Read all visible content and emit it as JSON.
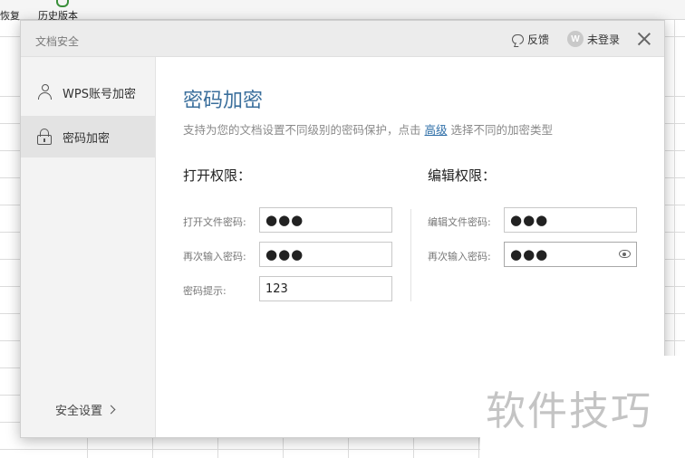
{
  "background": {
    "ribbon": {
      "restore_label": "恢复",
      "history_label": "历史版本"
    }
  },
  "dialog": {
    "title": "文档安全",
    "feedback_label": "反馈",
    "login_label": "未登录",
    "avatar_letter": "W"
  },
  "sidebar": {
    "items": [
      {
        "label": "WPS账号加密",
        "icon": "user-icon",
        "active": false
      },
      {
        "label": "密码加密",
        "icon": "lock-icon",
        "active": true
      }
    ],
    "security_settings": "安全设置"
  },
  "main": {
    "heading": "密码加密",
    "subtitle_prefix": "支持为您的文档设置不同级别的密码保护，点击 ",
    "subtitle_link": "高级",
    "subtitle_suffix": " 选择不同的加密类型",
    "open_section": {
      "label": "打开权限：",
      "password_label": "打开文件密码:",
      "password_value": "●●●",
      "confirm_label": "再次输入密码:",
      "confirm_value": "●●●",
      "hint_label": "密码提示:",
      "hint_value": "123"
    },
    "edit_section": {
      "label": "编辑权限：",
      "password_label": "编辑文件密码:",
      "password_value": "●●●",
      "confirm_label": "再次输入密码:",
      "confirm_value": "●●●"
    }
  },
  "watermark": "软件技巧",
  "colors": {
    "heading": "#3b6f9c",
    "link": "#2f6fa8",
    "sidebar_active": "#e3e3e3"
  }
}
